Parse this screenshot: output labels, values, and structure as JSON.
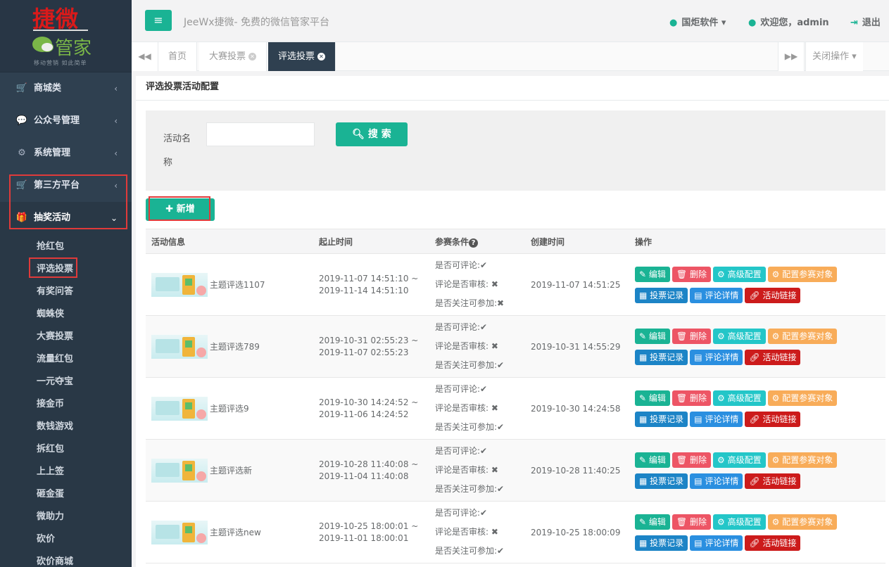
{
  "logo": {
    "brand_top": "捷微",
    "brand_bottom": "管家",
    "slogan": "移动营销 如此简单"
  },
  "sidebar": {
    "menu": [
      {
        "label": "商城类",
        "icon": "cart-icon",
        "glyph": "🛒",
        "arrow": "‹"
      },
      {
        "label": "公众号管理",
        "icon": "wechat-icon",
        "glyph": "💬",
        "arrow": "‹"
      },
      {
        "label": "系统管理",
        "icon": "gear-icon",
        "glyph": "⚙",
        "arrow": "‹"
      },
      {
        "label": "第三方平台",
        "icon": "cart-icon",
        "glyph": "🛒",
        "arrow": "‹"
      },
      {
        "label": "抽奖活动",
        "icon": "gift-icon",
        "glyph": "🎁",
        "arrow": "⌄"
      }
    ],
    "sub_items": [
      "抢红包",
      "评选投票",
      "有奖问答",
      "蜘蛛侠",
      "大赛投票",
      "流量红包",
      "一元夺宝",
      "接金币",
      "数钱游戏",
      "拆红包",
      "上上签",
      "砸金蛋",
      "微助力",
      "砍价",
      "砍价商城"
    ]
  },
  "header": {
    "menu_glyph": "≡",
    "title": "JeeWx捷微- 免费的微信管家平台",
    "company": "国炬软件",
    "welcome": "欢迎您，admin",
    "logout": "退出"
  },
  "tabs": {
    "prev": "◀◀",
    "next": "▶▶",
    "items": [
      "首页",
      "大赛投票",
      "评选投票"
    ],
    "close_ops": "关闭操作"
  },
  "panel": {
    "title": "评选投票活动配置",
    "search_label": "活动名称",
    "search_value": "",
    "search_button": "搜 索",
    "add_button": "新增"
  },
  "table": {
    "headers": [
      "活动信息",
      "起止时间",
      "参赛条件",
      "创建时间",
      "操作"
    ],
    "cond_labels": [
      "是否可评论:",
      "评论是否审核:",
      "是否关注可参加:"
    ],
    "op_labels": [
      "编辑",
      "删除",
      "高级配置",
      "配置参赛对象",
      "投票记录",
      "评论详情",
      "活动链接"
    ],
    "rows": [
      {
        "name": "主题评选1107",
        "start": "2019-11-07 14:51:10 ~",
        "end": "2019-11-14 14:51:10",
        "c1": "✔",
        "c2": "✖",
        "c3": "✖",
        "created": "2019-11-07 14:51:25"
      },
      {
        "name": "主题评选789",
        "start": "2019-10-31 02:55:23 ~",
        "end": "2019-11-07 02:55:23",
        "c1": "✔",
        "c2": "✖",
        "c3": "✔",
        "created": "2019-10-31 14:55:29"
      },
      {
        "name": "主题评选9",
        "start": "2019-10-30 14:24:52 ~",
        "end": "2019-11-06 14:24:52",
        "c1": "✔",
        "c2": "✖",
        "c3": "✔",
        "created": "2019-10-30 14:24:58"
      },
      {
        "name": "主题评选新",
        "start": "2019-10-28 11:40:08 ~",
        "end": "2019-11-04 11:40:08",
        "c1": "✔",
        "c2": "✖",
        "c3": "✔",
        "created": "2019-10-28 11:40:25"
      },
      {
        "name": "主题评选new",
        "start": "2019-10-25 18:00:01 ~",
        "end": "2019-11-01 18:00:01",
        "c1": "✔",
        "c2": "✖",
        "c3": "✔",
        "created": "2019-10-25 18:00:09"
      }
    ]
  }
}
